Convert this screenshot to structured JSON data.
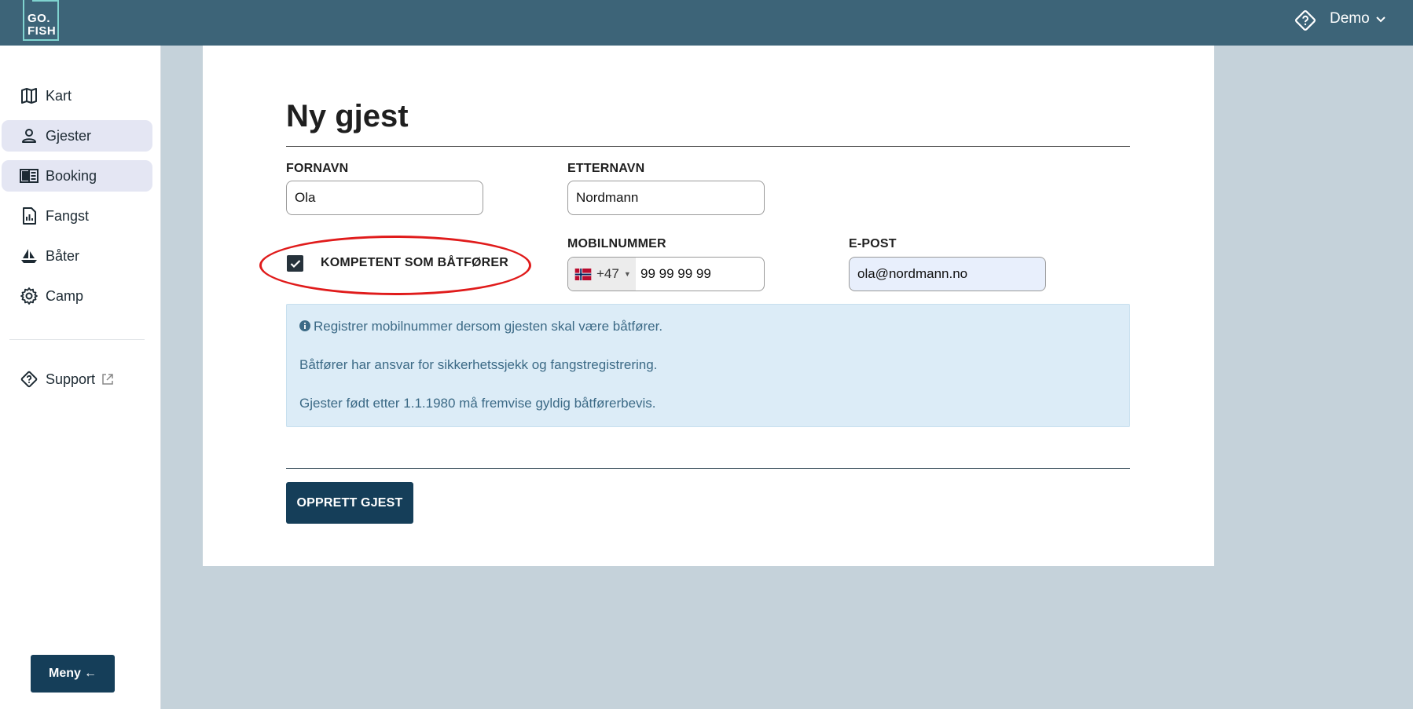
{
  "header": {
    "logo_text": "GO.\nFISH",
    "help_icon": "help-diamond-icon",
    "user_name": "Demo",
    "chevron_icon": "chevron-down-icon"
  },
  "sidebar": {
    "items": [
      {
        "label": "Kart",
        "icon": "map-icon",
        "active": false
      },
      {
        "label": "Gjester",
        "icon": "person-icon",
        "active": true
      },
      {
        "label": "Booking",
        "icon": "book-icon",
        "active": true
      },
      {
        "label": "Fangst",
        "icon": "report-icon",
        "active": false
      },
      {
        "label": "Båter",
        "icon": "sailboat-icon",
        "active": false
      },
      {
        "label": "Camp",
        "icon": "gear-icon",
        "active": false
      }
    ],
    "support": {
      "label": "Support",
      "icon": "help-diamond-icon",
      "external_icon": "external-link-icon"
    },
    "menu_button": {
      "label": "Meny",
      "icon": "arrow-left-icon",
      "arrow": "←"
    }
  },
  "form": {
    "title": "Ny gjest",
    "first_name": {
      "label": "FORNAVN",
      "value": "Ola"
    },
    "last_name": {
      "label": "ETTERNAVN",
      "value": "Nordmann"
    },
    "boat_driver": {
      "label": "KOMPETENT SOM BÅTFØRER",
      "checked": true
    },
    "mobile": {
      "label": "MOBILNUMMER",
      "country_code": "+47",
      "flag": "norway-flag-icon",
      "value": "99 99 99 99"
    },
    "email": {
      "label": "E-POST",
      "value": "ola@nordmann.no"
    },
    "info": {
      "icon": "info-icon",
      "lines": [
        "Registrer mobilnummer dersom gjesten skal være båtfører.",
        "Båtfører har ansvar for sikkerhetssjekk og fangstregistrering.",
        "Gjester født etter 1.1.1980 må fremvise gyldig båtførerbevis."
      ]
    },
    "submit_label": "OPPRETT GJEST"
  },
  "colors": {
    "topbar": "#3d6478",
    "primary_button": "#153e59",
    "background": "#c5d2da",
    "info_bg": "#dcecf7",
    "annotation": "#e01b1b"
  }
}
